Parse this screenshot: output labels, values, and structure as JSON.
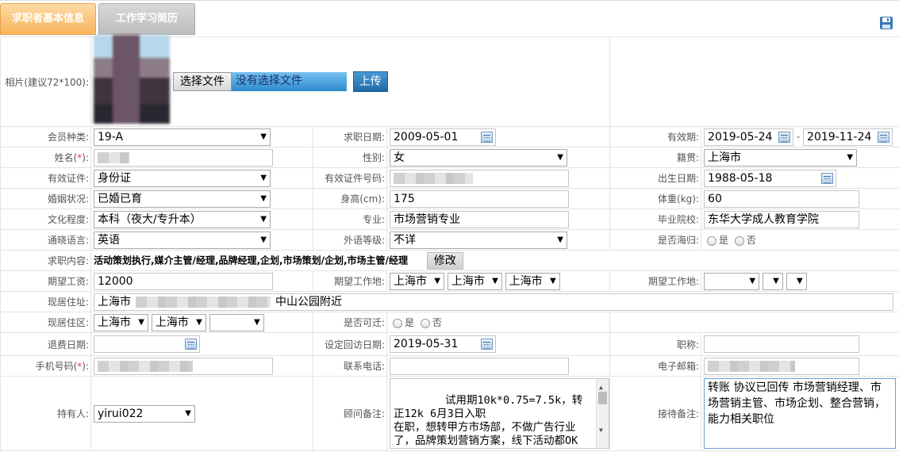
{
  "tabs": [
    {
      "label": "求职者基本信息"
    },
    {
      "label": "工作学习简历"
    }
  ],
  "photo": {
    "label": "相片(建议72*100):",
    "choose_file": "选择文件",
    "no_file": "没有选择文件",
    "upload": "上传"
  },
  "labels": {
    "member_type": "会员种类:",
    "apply_date": "求职日期:",
    "valid_period": "有效期:",
    "name": "姓名(",
    "name_star": "*",
    "name_close": "):",
    "gender": "性别:",
    "native": "籍贯:",
    "id_type": "有效证件:",
    "id_number": "有效证件号码:",
    "birth": "出生日期:",
    "marital": "婚姻状况:",
    "height": "身高(cm):",
    "weight": "体重(kg):",
    "education": "文化程度:",
    "major": "专业:",
    "school": "毕业院校:",
    "language": "通晓语言:",
    "lang_level": "外语等级:",
    "overseas": "是否海归:",
    "job_content": "求职内容:",
    "modify": "修改",
    "expected_salary": "期望工资:",
    "expected_loc": "期望工作地:",
    "expected_loc2": "期望工作地:",
    "address": "现居住址:",
    "area": "现居住区:",
    "relocate": "是否可迁:",
    "refund_date": "退费日期:",
    "revisit_date": "设定回访日期:",
    "title": "职称:",
    "mobile": "手机号码(",
    "mobile_star": "*",
    "mobile_close": "):",
    "phone": "联系电话:",
    "email": "电子邮箱:",
    "holder": "持有人:",
    "advisor_note": "顾问备注:",
    "reception_note": "接待备注:",
    "yes": "是",
    "no": "否"
  },
  "values": {
    "member_type": "19-A",
    "apply_date": "2009-05-01",
    "valid_from": "2019-05-24",
    "valid_sep": "-",
    "valid_to": "2019-11-24",
    "gender": "女",
    "native": "上海市",
    "id_type": "身份证",
    "birth": "1988-05-18",
    "marital": "已婚已育",
    "height": "175",
    "weight": "60",
    "education": "本科（夜大/专升本）",
    "major": "市场营销专业",
    "school": "东华大学成人教育学院",
    "language": "英语",
    "lang_level": "不详",
    "job_content": "活动策划执行,媒介主管/经理,品牌经理,企划,市场策划/企划,市场主管/经理",
    "expected_salary": "12000",
    "loc1": "上海市",
    "loc2": "上海市",
    "loc3": "上海市",
    "address_prefix": "上海市",
    "address_suffix": "中山公园附近",
    "area1": "上海市",
    "area2": "上海市",
    "revisit_date": "2019-05-31",
    "holder": "yirui022",
    "advisor_note": "试用期10k*0.75=7.5k，转正12k 6月3日入职\n在职，想转甲方市场部，不做广告行业了，品牌策划营销方案，线下活动都OK 服装快消化妆品都行，行业不限制",
    "reception_note": "转账 协议已回传 市场营销经理、市场营销主管、市场企划、整合营销，能力相关职位"
  },
  "icons": {
    "save": "save-icon",
    "calendar": "calendar-icon",
    "dropdown": "dropdown-arrow-icon"
  },
  "colors": {
    "tab_active": "#f7b55b",
    "tab_inactive": "#bdbdbd",
    "required": "#e23b3b",
    "upload_button": "#1f6aa8"
  }
}
